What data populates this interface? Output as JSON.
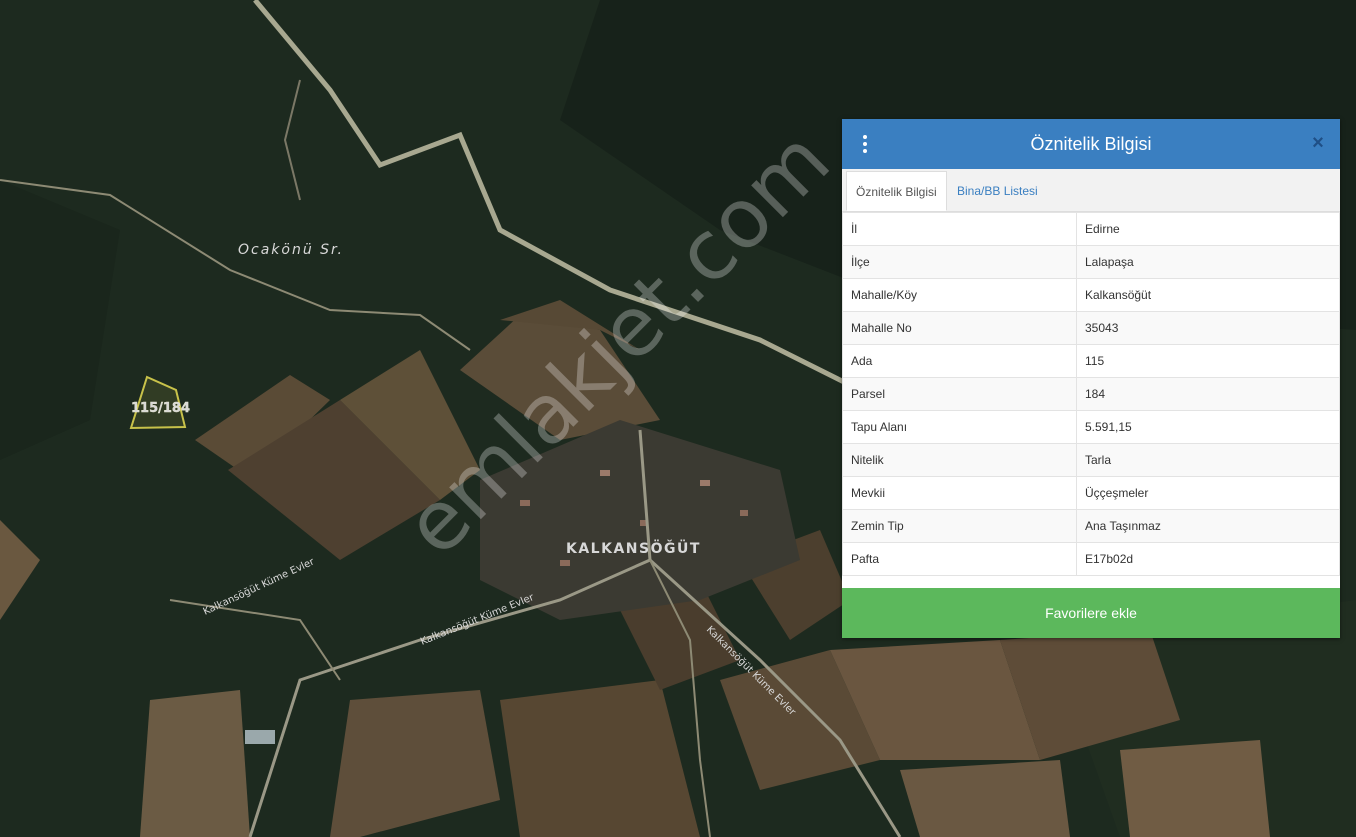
{
  "map": {
    "labels": {
      "stream": "Ocakönü Sr.",
      "village": "KALKANSÖĞÜT",
      "road1": "Kalkansöğüt Küme Evler",
      "road2": "Kalkansöğüt Küme Evler",
      "road3": "Kalkansöğüt Küme Evler",
      "parcel": "115/184"
    },
    "watermark": "emlakjet.com",
    "colors": {
      "forest": "#1d2a1f",
      "parcel_outline": "#c8c24a",
      "road": "#9a9a86",
      "panel_header": "#3a7fc1",
      "button": "#5cb85c"
    }
  },
  "panel": {
    "title": "Öznitelik Bilgisi",
    "menu_icon": "vertical-dots-icon",
    "close_icon": "close-icon",
    "close_symbol": "×",
    "tabs": [
      {
        "label": "Öznitelik Bilgisi",
        "active": true
      },
      {
        "label": "Bina/BB Listesi",
        "active": false
      }
    ],
    "rows": [
      {
        "key": "İl",
        "value": "Edirne"
      },
      {
        "key": "İlçe",
        "value": "Lalapaşa"
      },
      {
        "key": "Mahalle/Köy",
        "value": "Kalkansöğüt"
      },
      {
        "key": "Mahalle No",
        "value": "35043"
      },
      {
        "key": "Ada",
        "value": "115"
      },
      {
        "key": "Parsel",
        "value": "184"
      },
      {
        "key": "Tapu Alanı",
        "value": "5.591,15"
      },
      {
        "key": "Nitelik",
        "value": "Tarla"
      },
      {
        "key": "Mevkii",
        "value": "Üççeşmeler"
      },
      {
        "key": "Zemin Tip",
        "value": "Ana Taşınmaz"
      },
      {
        "key": "Pafta",
        "value": "E17b02d"
      }
    ],
    "button_label": "Favorilere ekle"
  }
}
